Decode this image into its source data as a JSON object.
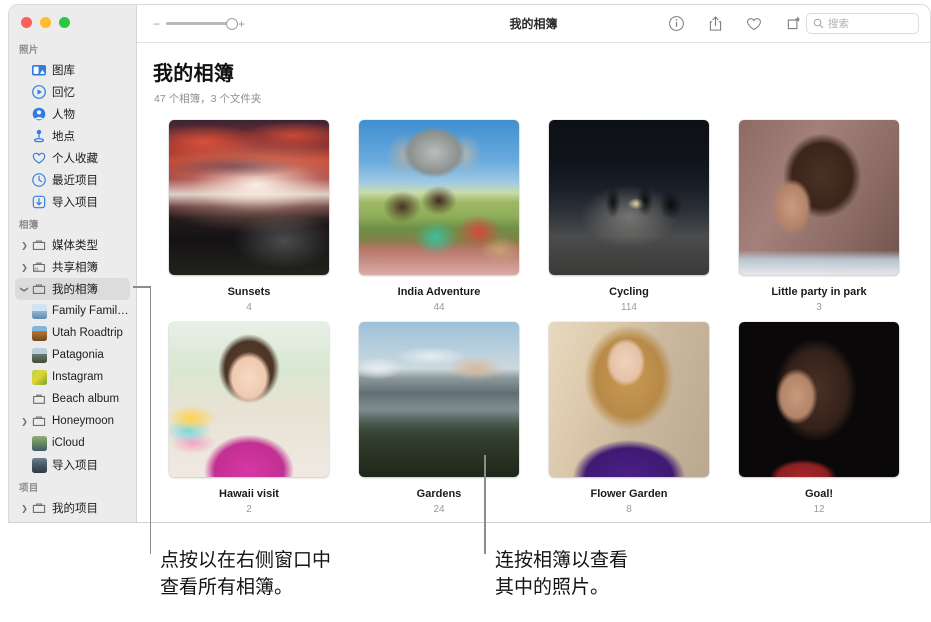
{
  "window": {
    "title": "我的相簿",
    "traffic_lights": [
      "close",
      "minimize",
      "zoom"
    ]
  },
  "toolbar": {
    "zoom_out_label": "−",
    "zoom_in_label": "+",
    "icons": [
      {
        "name": "info-icon",
        "glyph": "ⓘ"
      },
      {
        "name": "share-icon",
        "glyph": "share"
      },
      {
        "name": "favorite-heart-icon",
        "glyph": "heart"
      },
      {
        "name": "rotate-icon",
        "glyph": "rotate"
      }
    ],
    "search": {
      "placeholder": "搜索",
      "value": ""
    }
  },
  "sidebar": {
    "sections": [
      {
        "title": "照片",
        "items": [
          {
            "label": "图库",
            "icon": "library-icon",
            "disclosure": "",
            "selected": false
          },
          {
            "label": "回忆",
            "icon": "memories-icon",
            "disclosure": "",
            "selected": false
          },
          {
            "label": "人物",
            "icon": "people-icon",
            "disclosure": "",
            "selected": false
          },
          {
            "label": "地点",
            "icon": "places-icon",
            "disclosure": "",
            "selected": false
          },
          {
            "label": "个人收藏",
            "icon": "heart-icon",
            "disclosure": "",
            "selected": false
          },
          {
            "label": "最近项目",
            "icon": "recents-icon",
            "disclosure": "",
            "selected": false
          },
          {
            "label": "导入项目",
            "icon": "imports-icon",
            "disclosure": "",
            "selected": false
          }
        ]
      },
      {
        "title": "相簿",
        "items": [
          {
            "label": "媒体类型",
            "icon": "folder-icon",
            "disclosure": "collapsed",
            "selected": false
          },
          {
            "label": "共享相簿",
            "icon": "shared-album-icon",
            "disclosure": "collapsed",
            "selected": false
          },
          {
            "label": "我的相簿",
            "icon": "folder-icon",
            "disclosure": "expanded",
            "selected": true
          },
          {
            "label": "Family Family…",
            "icon": "album-thumb-sail",
            "disclosure": "",
            "selected": false,
            "child": true
          },
          {
            "label": "Utah Roadtrip",
            "icon": "album-thumb-utah",
            "disclosure": "",
            "selected": false,
            "child": true
          },
          {
            "label": "Patagonia",
            "icon": "album-thumb-patagonia",
            "disclosure": "",
            "selected": false,
            "child": true
          },
          {
            "label": "Instagram",
            "icon": "album-thumb-instagram",
            "disclosure": "",
            "selected": false,
            "child": true
          },
          {
            "label": "Beach album",
            "icon": "album-icon",
            "disclosure": "",
            "selected": false,
            "child": true
          },
          {
            "label": "Honeymoon",
            "icon": "folder-icon",
            "disclosure": "collapsed",
            "selected": false,
            "child": true
          },
          {
            "label": "iCloud",
            "icon": "album-thumb-icloud",
            "disclosure": "",
            "selected": false,
            "child": true
          },
          {
            "label": "导入项目",
            "icon": "album-thumb-import",
            "disclosure": "",
            "selected": false,
            "child": true
          }
        ]
      },
      {
        "title": "项目",
        "items": [
          {
            "label": "我的项目",
            "icon": "folder-icon",
            "disclosure": "collapsed",
            "selected": false
          }
        ]
      }
    ]
  },
  "main": {
    "page_title": "我的相簿",
    "subtitle": "47 个相簿，3 个文件夹",
    "albums": [
      {
        "name": "Sunsets",
        "count": "4",
        "art": "sunset"
      },
      {
        "name": "India Adventure",
        "count": "44",
        "art": "kids"
      },
      {
        "name": "Cycling",
        "count": "114",
        "art": "cycling"
      },
      {
        "name": "Little party in park",
        "count": "3",
        "art": "portrait-curly"
      },
      {
        "name": "Hawaii visit",
        "count": "2",
        "art": "girl-pink"
      },
      {
        "name": "Gardens",
        "count": "24",
        "art": "patagonia"
      },
      {
        "name": "Flower Garden",
        "count": "8",
        "art": "woman-purple"
      },
      {
        "name": "Goal!",
        "count": "12",
        "art": "woman-dark"
      }
    ]
  },
  "callouts": [
    {
      "name": "sidebar-callout",
      "line1": "点按以在右侧窗口中",
      "line2": "查看所有相簿。"
    },
    {
      "name": "album-callout",
      "line1": "连按相簿以查看",
      "line2": "其中的照片。"
    }
  ],
  "colors": {
    "accent_blue": "#2f7de1",
    "sidebar_bg": "#ececec",
    "selected_row": "#dcdcdc",
    "leader_line": "#8c8c8c",
    "muted_text": "#9a9a9a"
  }
}
